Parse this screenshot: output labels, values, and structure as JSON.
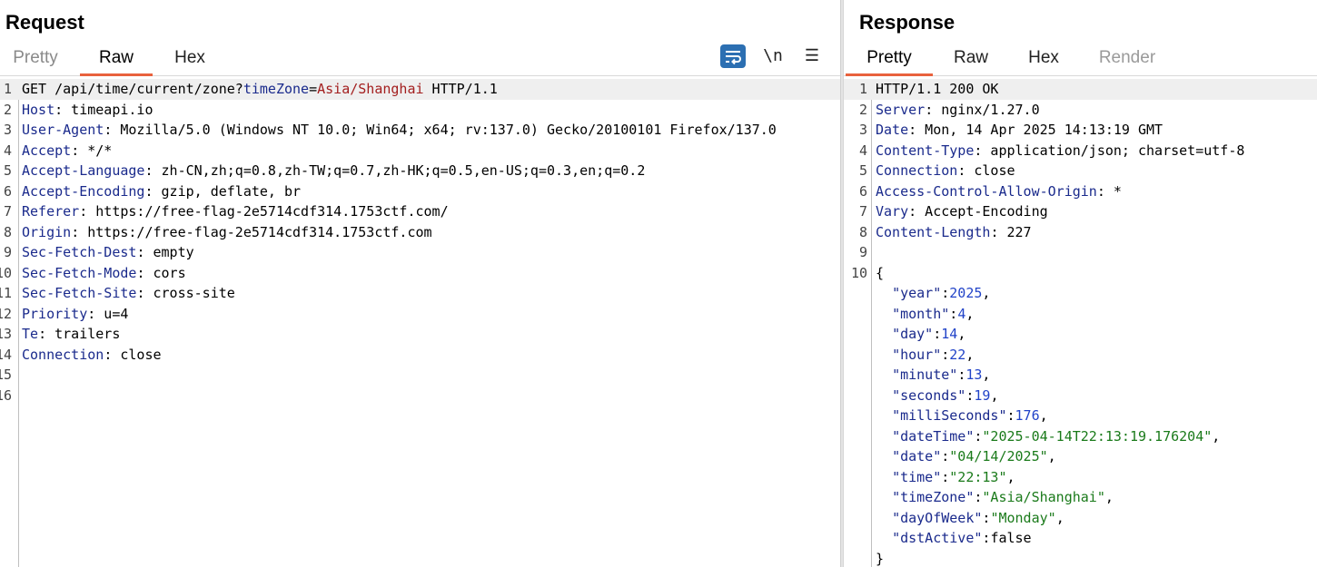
{
  "request": {
    "title": "Request",
    "tabs": [
      "Pretty",
      "Raw",
      "Hex"
    ],
    "selected_tab": "Raw",
    "toolbar": {
      "newline_label": "\\n",
      "menu_label": "☰",
      "wrap_icon": "wrap-lines-icon"
    },
    "lines": [
      {
        "n": "1",
        "parts": [
          [
            "v",
            "GET /api/time/current/zone?"
          ],
          [
            "k",
            "timeZone"
          ],
          [
            "sep",
            "="
          ],
          [
            "pv",
            "Asia/Shanghai"
          ],
          [
            "v",
            " HTTP/1.1"
          ]
        ]
      },
      {
        "n": "2",
        "parts": [
          [
            "k",
            "Host"
          ],
          [
            "v",
            ": timeapi.io"
          ]
        ]
      },
      {
        "n": "3",
        "parts": [
          [
            "k",
            "User-Agent"
          ],
          [
            "v",
            ": Mozilla/5.0 (Windows NT 10.0; Win64; x64; rv:137.0) Gecko/20100101 Firefox/137.0"
          ]
        ]
      },
      {
        "n": "4",
        "parts": [
          [
            "k",
            "Accept"
          ],
          [
            "v",
            ": */*"
          ]
        ]
      },
      {
        "n": "5",
        "parts": [
          [
            "k",
            "Accept-Language"
          ],
          [
            "v",
            ": zh-CN,zh;q=0.8,zh-TW;q=0.7,zh-HK;q=0.5,en-US;q=0.3,en;q=0.2"
          ]
        ]
      },
      {
        "n": "6",
        "parts": [
          [
            "k",
            "Accept-Encoding"
          ],
          [
            "v",
            ": gzip, deflate, br"
          ]
        ]
      },
      {
        "n": "7",
        "parts": [
          [
            "k",
            "Referer"
          ],
          [
            "v",
            ": https://free-flag-2e5714cdf314.1753ctf.com/"
          ]
        ]
      },
      {
        "n": "8",
        "parts": [
          [
            "k",
            "Origin"
          ],
          [
            "v",
            ": https://free-flag-2e5714cdf314.1753ctf.com"
          ]
        ]
      },
      {
        "n": "9",
        "parts": [
          [
            "k",
            "Sec-Fetch-Dest"
          ],
          [
            "v",
            ": empty"
          ]
        ]
      },
      {
        "n": "10",
        "parts": [
          [
            "k",
            "Sec-Fetch-Mode"
          ],
          [
            "v",
            ": cors"
          ]
        ]
      },
      {
        "n": "11",
        "parts": [
          [
            "k",
            "Sec-Fetch-Site"
          ],
          [
            "v",
            ": cross-site"
          ]
        ]
      },
      {
        "n": "12",
        "parts": [
          [
            "k",
            "Priority"
          ],
          [
            "v",
            ": u=4"
          ]
        ]
      },
      {
        "n": "13",
        "parts": [
          [
            "k",
            "Te"
          ],
          [
            "v",
            ": trailers"
          ]
        ]
      },
      {
        "n": "14",
        "parts": [
          [
            "k",
            "Connection"
          ],
          [
            "v",
            ": close"
          ]
        ]
      },
      {
        "n": "15",
        "parts": []
      },
      {
        "n": "16",
        "parts": []
      }
    ]
  },
  "response": {
    "title": "Response",
    "tabs": [
      "Pretty",
      "Raw",
      "Hex",
      "Render"
    ],
    "selected_tab": "Pretty",
    "lines": [
      {
        "n": "1",
        "parts": [
          [
            "v",
            "HTTP/1.1 200 OK"
          ]
        ]
      },
      {
        "n": "2",
        "parts": [
          [
            "k",
            "Server"
          ],
          [
            "v",
            ": nginx/1.27.0"
          ]
        ]
      },
      {
        "n": "3",
        "parts": [
          [
            "k",
            "Date"
          ],
          [
            "v",
            ": Mon, 14 Apr 2025 14:13:19 GMT"
          ]
        ]
      },
      {
        "n": "4",
        "parts": [
          [
            "k",
            "Content-Type"
          ],
          [
            "v",
            ": application/json; charset=utf-8"
          ]
        ]
      },
      {
        "n": "5",
        "parts": [
          [
            "k",
            "Connection"
          ],
          [
            "v",
            ": close"
          ]
        ]
      },
      {
        "n": "6",
        "parts": [
          [
            "k",
            "Access-Control-Allow-Origin"
          ],
          [
            "v",
            ": *"
          ]
        ]
      },
      {
        "n": "7",
        "parts": [
          [
            "k",
            "Vary"
          ],
          [
            "v",
            ": Accept-Encoding"
          ]
        ]
      },
      {
        "n": "8",
        "parts": [
          [
            "k",
            "Content-Length"
          ],
          [
            "v",
            ": 227"
          ]
        ]
      },
      {
        "n": "9",
        "parts": []
      },
      {
        "n": "10",
        "parts": [
          [
            "v",
            "{"
          ]
        ]
      },
      {
        "n": "",
        "parts": [
          [
            "v",
            "  "
          ],
          [
            "js-key",
            "\"year\""
          ],
          [
            "v",
            ":"
          ],
          [
            "js-num",
            "2025"
          ],
          [
            "v",
            ","
          ]
        ]
      },
      {
        "n": "",
        "parts": [
          [
            "v",
            "  "
          ],
          [
            "js-key",
            "\"month\""
          ],
          [
            "v",
            ":"
          ],
          [
            "js-num",
            "4"
          ],
          [
            "v",
            ","
          ]
        ]
      },
      {
        "n": "",
        "parts": [
          [
            "v",
            "  "
          ],
          [
            "js-key",
            "\"day\""
          ],
          [
            "v",
            ":"
          ],
          [
            "js-num",
            "14"
          ],
          [
            "v",
            ","
          ]
        ]
      },
      {
        "n": "",
        "parts": [
          [
            "v",
            "  "
          ],
          [
            "js-key",
            "\"hour\""
          ],
          [
            "v",
            ":"
          ],
          [
            "js-num",
            "22"
          ],
          [
            "v",
            ","
          ]
        ]
      },
      {
        "n": "",
        "parts": [
          [
            "v",
            "  "
          ],
          [
            "js-key",
            "\"minute\""
          ],
          [
            "v",
            ":"
          ],
          [
            "js-num",
            "13"
          ],
          [
            "v",
            ","
          ]
        ]
      },
      {
        "n": "",
        "parts": [
          [
            "v",
            "  "
          ],
          [
            "js-key",
            "\"seconds\""
          ],
          [
            "v",
            ":"
          ],
          [
            "js-num",
            "19"
          ],
          [
            "v",
            ","
          ]
        ]
      },
      {
        "n": "",
        "parts": [
          [
            "v",
            "  "
          ],
          [
            "js-key",
            "\"milliSeconds\""
          ],
          [
            "v",
            ":"
          ],
          [
            "js-num",
            "176"
          ],
          [
            "v",
            ","
          ]
        ]
      },
      {
        "n": "",
        "parts": [
          [
            "v",
            "  "
          ],
          [
            "js-key",
            "\"dateTime\""
          ],
          [
            "v",
            ":"
          ],
          [
            "js-str",
            "\"2025-04-14T22:13:19.176204\""
          ],
          [
            "v",
            ","
          ]
        ]
      },
      {
        "n": "",
        "parts": [
          [
            "v",
            "  "
          ],
          [
            "js-key",
            "\"date\""
          ],
          [
            "v",
            ":"
          ],
          [
            "js-str",
            "\"04/14/2025\""
          ],
          [
            "v",
            ","
          ]
        ]
      },
      {
        "n": "",
        "parts": [
          [
            "v",
            "  "
          ],
          [
            "js-key",
            "\"time\""
          ],
          [
            "v",
            ":"
          ],
          [
            "js-str",
            "\"22:13\""
          ],
          [
            "v",
            ","
          ]
        ]
      },
      {
        "n": "",
        "parts": [
          [
            "v",
            "  "
          ],
          [
            "js-key",
            "\"timeZone\""
          ],
          [
            "v",
            ":"
          ],
          [
            "js-str",
            "\"Asia/Shanghai\""
          ],
          [
            "v",
            ","
          ]
        ]
      },
      {
        "n": "",
        "parts": [
          [
            "v",
            "  "
          ],
          [
            "js-key",
            "\"dayOfWeek\""
          ],
          [
            "v",
            ":"
          ],
          [
            "js-str",
            "\"Monday\""
          ],
          [
            "v",
            ","
          ]
        ]
      },
      {
        "n": "",
        "parts": [
          [
            "v",
            "  "
          ],
          [
            "js-key",
            "\"dstActive\""
          ],
          [
            "v",
            ":"
          ],
          [
            "js-lit",
            "false"
          ]
        ]
      },
      {
        "n": "",
        "parts": [
          [
            "v",
            "}"
          ]
        ]
      }
    ]
  },
  "colors": {
    "accent": "#e8613d",
    "header_name": "#1a2a8c",
    "param_value": "#a31e1e",
    "json_number": "#2143c8",
    "json_string": "#1a7a1a",
    "wrap_button": "#2c6fb2"
  }
}
